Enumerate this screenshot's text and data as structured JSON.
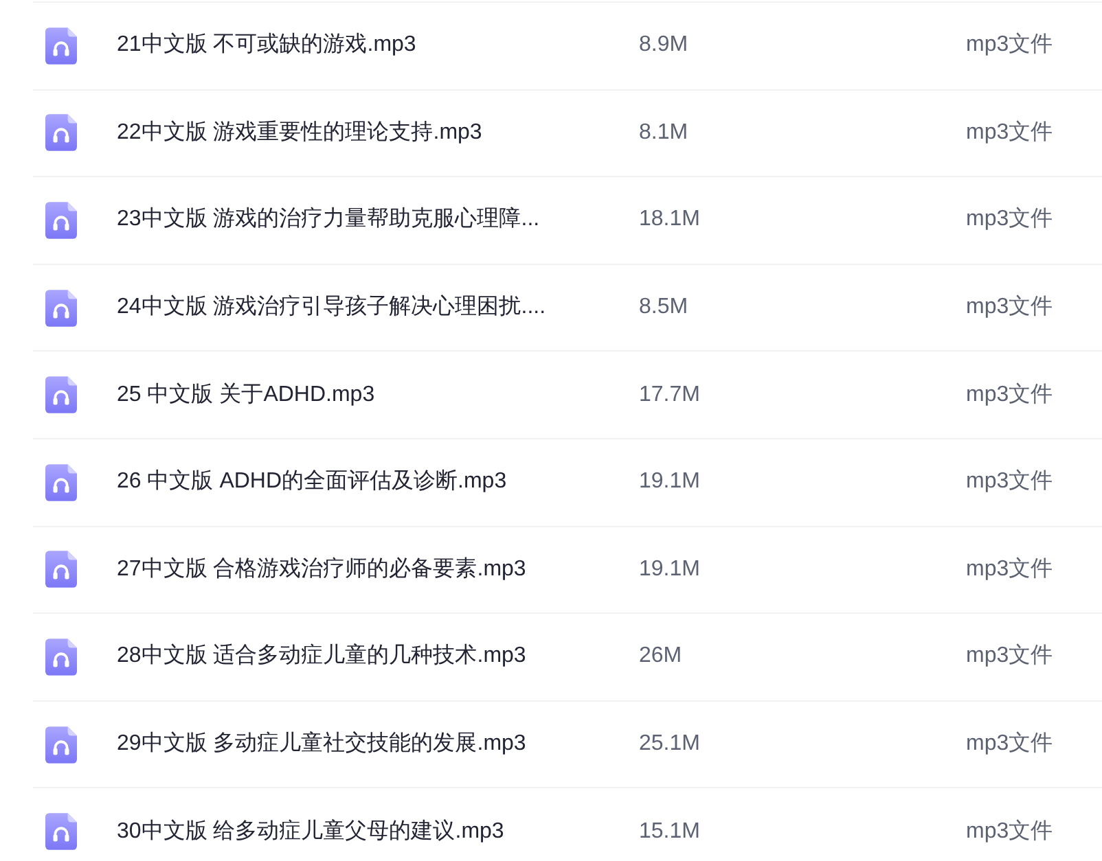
{
  "files": [
    {
      "name": "21中文版 不可或缺的游戏.mp3",
      "size": "8.9M",
      "type": "mp3文件"
    },
    {
      "name": "22中文版 游戏重要性的理论支持.mp3",
      "size": "8.1M",
      "type": "mp3文件"
    },
    {
      "name": "23中文版 游戏的治疗力量帮助克服心理障...",
      "size": "18.1M",
      "type": "mp3文件"
    },
    {
      "name": "24中文版 游戏治疗引导孩子解决心理困扰....",
      "size": "8.5M",
      "type": "mp3文件"
    },
    {
      "name": "25 中文版 关于ADHD.mp3",
      "size": "17.7M",
      "type": "mp3文件"
    },
    {
      "name": "26 中文版 ADHD的全面评估及诊断.mp3",
      "size": "19.1M",
      "type": "mp3文件"
    },
    {
      "name": "27中文版 合格游戏治疗师的必备要素.mp3",
      "size": "19.1M",
      "type": "mp3文件"
    },
    {
      "name": "28中文版 适合多动症儿童的几种技术.mp3",
      "size": "26M",
      "type": "mp3文件"
    },
    {
      "name": "29中文版 多动症儿童社交技能的发展.mp3",
      "size": "25.1M",
      "type": "mp3文件"
    },
    {
      "name": "30中文版 给多动症儿童父母的建议.mp3",
      "size": "15.1M",
      "type": "mp3文件"
    }
  ]
}
